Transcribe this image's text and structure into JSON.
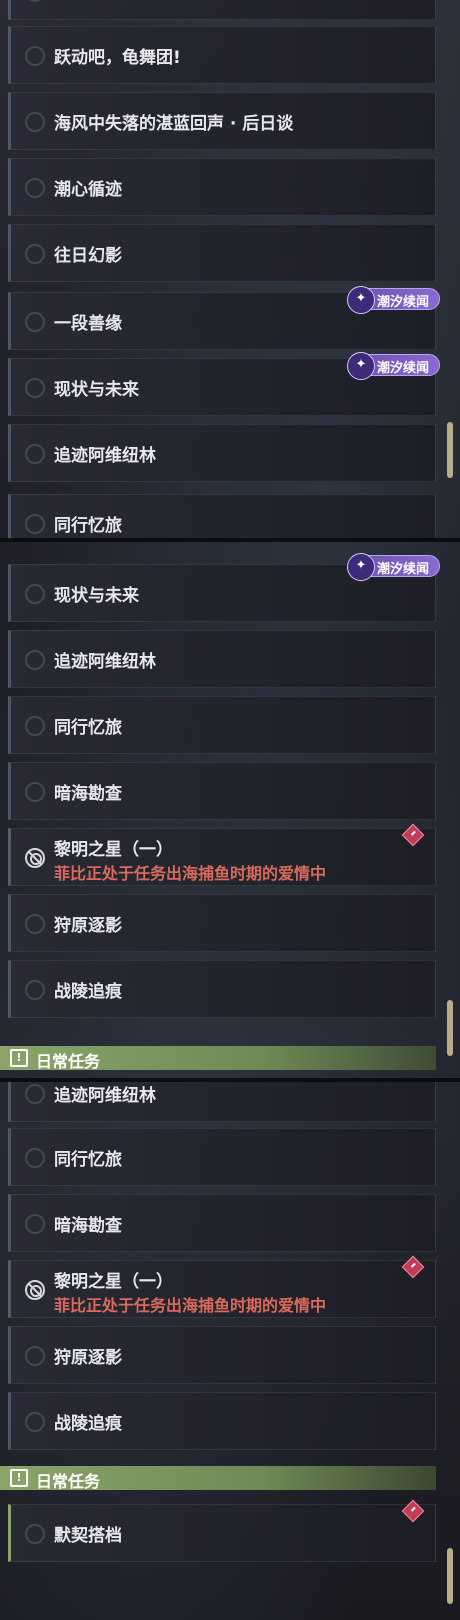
{
  "badge_label": "潮汐续闻",
  "daily_header": "日常任务",
  "panel1": {
    "quests": [
      {
        "title": ""
      },
      {
        "title": "跃动吧，龟舞团!"
      },
      {
        "title": "海风中失落的湛蓝回声 · 后日谈"
      },
      {
        "title": "潮心循迹"
      },
      {
        "title": "往日幻影"
      },
      {
        "title": "一段善缘"
      },
      {
        "title": "现状与未来"
      },
      {
        "title": "追迹阿维纽林"
      },
      {
        "title": "同行忆旅"
      }
    ]
  },
  "panel2": {
    "quests": [
      {
        "title": "现状与未来"
      },
      {
        "title": "追迹阿维纽林"
      },
      {
        "title": "同行忆旅"
      },
      {
        "title": "暗海勘查"
      },
      {
        "title": "黎明之星（一）",
        "subtitle": "菲比正处于任务出海捕鱼时期的爱情中"
      },
      {
        "title": "狩原逐影"
      },
      {
        "title": "战陵追痕"
      }
    ]
  },
  "panel3": {
    "quests": [
      {
        "title": "追迹阿维纽林"
      },
      {
        "title": "同行忆旅"
      },
      {
        "title": "暗海勘查"
      },
      {
        "title": "黎明之星（一）",
        "subtitle": "菲比正处于任务出海捕鱼时期的爱情中"
      },
      {
        "title": "狩原逐影"
      },
      {
        "title": "战陵追痕"
      }
    ],
    "daily_quests": [
      {
        "title": "默契搭档"
      }
    ]
  },
  "colors": {
    "badge": "#7b5cc4",
    "warning_text": "#d96a5c",
    "daily_header": "#8aa56a",
    "scrollbar": "#b7ad8a"
  }
}
